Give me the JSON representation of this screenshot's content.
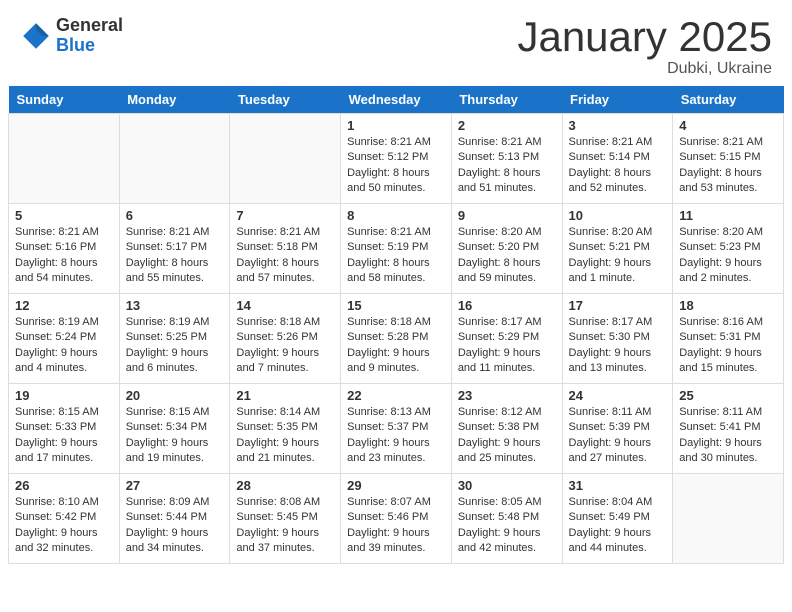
{
  "logo": {
    "general": "General",
    "blue": "Blue"
  },
  "title": "January 2025",
  "subtitle": "Dubki, Ukraine",
  "days_header": [
    "Sunday",
    "Monday",
    "Tuesday",
    "Wednesday",
    "Thursday",
    "Friday",
    "Saturday"
  ],
  "weeks": [
    [
      {
        "day": "",
        "info": ""
      },
      {
        "day": "",
        "info": ""
      },
      {
        "day": "",
        "info": ""
      },
      {
        "day": "1",
        "info": "Sunrise: 8:21 AM\nSunset: 5:12 PM\nDaylight: 8 hours and 50 minutes."
      },
      {
        "day": "2",
        "info": "Sunrise: 8:21 AM\nSunset: 5:13 PM\nDaylight: 8 hours and 51 minutes."
      },
      {
        "day": "3",
        "info": "Sunrise: 8:21 AM\nSunset: 5:14 PM\nDaylight: 8 hours and 52 minutes."
      },
      {
        "day": "4",
        "info": "Sunrise: 8:21 AM\nSunset: 5:15 PM\nDaylight: 8 hours and 53 minutes."
      }
    ],
    [
      {
        "day": "5",
        "info": "Sunrise: 8:21 AM\nSunset: 5:16 PM\nDaylight: 8 hours and 54 minutes."
      },
      {
        "day": "6",
        "info": "Sunrise: 8:21 AM\nSunset: 5:17 PM\nDaylight: 8 hours and 55 minutes."
      },
      {
        "day": "7",
        "info": "Sunrise: 8:21 AM\nSunset: 5:18 PM\nDaylight: 8 hours and 57 minutes."
      },
      {
        "day": "8",
        "info": "Sunrise: 8:21 AM\nSunset: 5:19 PM\nDaylight: 8 hours and 58 minutes."
      },
      {
        "day": "9",
        "info": "Sunrise: 8:20 AM\nSunset: 5:20 PM\nDaylight: 8 hours and 59 minutes."
      },
      {
        "day": "10",
        "info": "Sunrise: 8:20 AM\nSunset: 5:21 PM\nDaylight: 9 hours and 1 minute."
      },
      {
        "day": "11",
        "info": "Sunrise: 8:20 AM\nSunset: 5:23 PM\nDaylight: 9 hours and 2 minutes."
      }
    ],
    [
      {
        "day": "12",
        "info": "Sunrise: 8:19 AM\nSunset: 5:24 PM\nDaylight: 9 hours and 4 minutes."
      },
      {
        "day": "13",
        "info": "Sunrise: 8:19 AM\nSunset: 5:25 PM\nDaylight: 9 hours and 6 minutes."
      },
      {
        "day": "14",
        "info": "Sunrise: 8:18 AM\nSunset: 5:26 PM\nDaylight: 9 hours and 7 minutes."
      },
      {
        "day": "15",
        "info": "Sunrise: 8:18 AM\nSunset: 5:28 PM\nDaylight: 9 hours and 9 minutes."
      },
      {
        "day": "16",
        "info": "Sunrise: 8:17 AM\nSunset: 5:29 PM\nDaylight: 9 hours and 11 minutes."
      },
      {
        "day": "17",
        "info": "Sunrise: 8:17 AM\nSunset: 5:30 PM\nDaylight: 9 hours and 13 minutes."
      },
      {
        "day": "18",
        "info": "Sunrise: 8:16 AM\nSunset: 5:31 PM\nDaylight: 9 hours and 15 minutes."
      }
    ],
    [
      {
        "day": "19",
        "info": "Sunrise: 8:15 AM\nSunset: 5:33 PM\nDaylight: 9 hours and 17 minutes."
      },
      {
        "day": "20",
        "info": "Sunrise: 8:15 AM\nSunset: 5:34 PM\nDaylight: 9 hours and 19 minutes."
      },
      {
        "day": "21",
        "info": "Sunrise: 8:14 AM\nSunset: 5:35 PM\nDaylight: 9 hours and 21 minutes."
      },
      {
        "day": "22",
        "info": "Sunrise: 8:13 AM\nSunset: 5:37 PM\nDaylight: 9 hours and 23 minutes."
      },
      {
        "day": "23",
        "info": "Sunrise: 8:12 AM\nSunset: 5:38 PM\nDaylight: 9 hours and 25 minutes."
      },
      {
        "day": "24",
        "info": "Sunrise: 8:11 AM\nSunset: 5:39 PM\nDaylight: 9 hours and 27 minutes."
      },
      {
        "day": "25",
        "info": "Sunrise: 8:11 AM\nSunset: 5:41 PM\nDaylight: 9 hours and 30 minutes."
      }
    ],
    [
      {
        "day": "26",
        "info": "Sunrise: 8:10 AM\nSunset: 5:42 PM\nDaylight: 9 hours and 32 minutes."
      },
      {
        "day": "27",
        "info": "Sunrise: 8:09 AM\nSunset: 5:44 PM\nDaylight: 9 hours and 34 minutes."
      },
      {
        "day": "28",
        "info": "Sunrise: 8:08 AM\nSunset: 5:45 PM\nDaylight: 9 hours and 37 minutes."
      },
      {
        "day": "29",
        "info": "Sunrise: 8:07 AM\nSunset: 5:46 PM\nDaylight: 9 hours and 39 minutes."
      },
      {
        "day": "30",
        "info": "Sunrise: 8:05 AM\nSunset: 5:48 PM\nDaylight: 9 hours and 42 minutes."
      },
      {
        "day": "31",
        "info": "Sunrise: 8:04 AM\nSunset: 5:49 PM\nDaylight: 9 hours and 44 minutes."
      },
      {
        "day": "",
        "info": ""
      }
    ]
  ]
}
